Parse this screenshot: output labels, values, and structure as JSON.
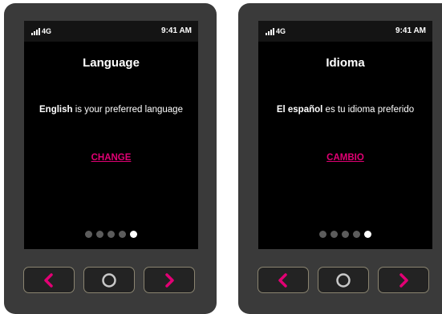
{
  "screens": [
    {
      "status": {
        "signal_icon": "signal-bars-icon",
        "network": "4G",
        "time": "9:41 AM"
      },
      "title": "Language",
      "message_bold": "English",
      "message_rest": " is your preferred language",
      "action_label": "CHANGE",
      "pager": {
        "total": 5,
        "active_index": 5
      }
    },
    {
      "status": {
        "signal_icon": "signal-bars-icon",
        "network": "4G",
        "time": "9:41 AM"
      },
      "title": "Idioma",
      "message_bold": "El español",
      "message_rest": " es tu idioma preferido",
      "action_label": "CAMBIO",
      "pager": {
        "total": 5,
        "active_index": 5
      }
    }
  ],
  "nav_buttons": {
    "back_icon": "chevron-left-icon",
    "home_icon": "circle-home-icon",
    "next_icon": "chevron-right-icon"
  },
  "colors": {
    "accent": "#e20074",
    "screen_bg": "#000000",
    "device_bg": "#3a3a3a",
    "dot_inactive": "#5c5c5c",
    "dot_active": "#ffffff"
  }
}
